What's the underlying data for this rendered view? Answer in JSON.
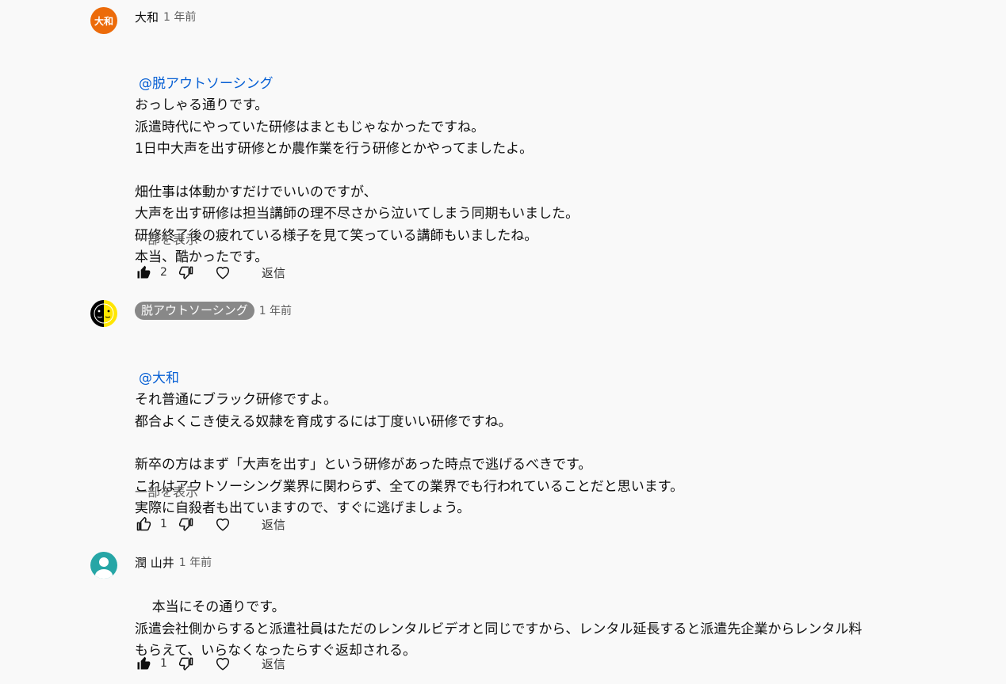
{
  "comments": [
    {
      "author": "大和",
      "avatar_text": "大和",
      "time": "1 年前",
      "mention": "@脱アウトソーシング",
      "text": "おっしゃる通りです。\n派遣時代にやっていた研修はまともじゃなかったですね。\n1日中大声を出す研修とか農作業を行う研修とかやってましたよ。\n\n畑仕事は体動かすだけでいいのですが、\n大声を出す研修は担当講師の理不尽さから泣いてしまう同期もいました。\n研修終了後の疲れている様子を見て笑っている講師もいましたね。\n本当、酷かったです。",
      "show_more": "一部を表示",
      "likes": "2",
      "reply": "返信"
    },
    {
      "author": "脱アウトソーシング",
      "time": "1 年前",
      "mention": "@大和",
      "text": "それ普通にブラック研修ですよ。\n都合よくこき使える奴隷を育成するには丁度いい研修ですね。\n\n新卒の方はまず「大声を出す」という研修があった時点で逃げるべきです。\nこれはアウトソーシング業界に関わらず、全ての業界でも行われていることだと思います。\n実際に自殺者も出ていますので、すぐに逃げましょう。",
      "show_more": "一部を表示",
      "likes": "1",
      "reply": "返信"
    },
    {
      "author": "潤 山井",
      "time": "1 年前",
      "text": "本当にその通りです。\n派遣会社側からすると派遣社員はただのレンタルビデオと同じですから、レンタル延長すると派遣先企業からレンタル料\nもらえて、いらなくなったらすぐ返却される。",
      "likes": "1",
      "reply": "返信"
    }
  ],
  "colors": {
    "background": "#f9f9f9",
    "link": "#065fd4",
    "secondary_text": "#606060",
    "avatar_orange": "#ec6b0a",
    "avatar_teal": "#26a6a6",
    "owner_chip": "#888888"
  },
  "icons": [
    "thumbs-up-filled-icon",
    "thumbs-up-outline-icon",
    "thumbs-down-icon",
    "heart-icon",
    "default-user-avatar-icon"
  ]
}
